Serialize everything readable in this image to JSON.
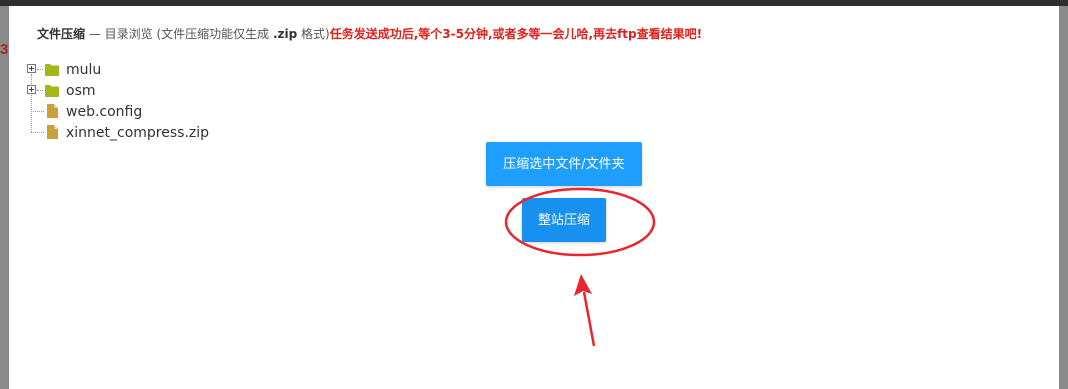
{
  "header": {
    "title": "文件压缩",
    "subtitle": " — 目录浏览 (文件压缩功能仅生成 ",
    "ext": ".zip",
    "subtitle_end": " 格式)",
    "warning": "任务发送成功后,等个3-5分钟,或者多等一会儿哈,再去ftp查看结果吧!"
  },
  "edge_fragment": "3",
  "tree": {
    "items": [
      {
        "label": "mulu",
        "type": "folder",
        "icon": "folder-icon"
      },
      {
        "label": "osm",
        "type": "folder",
        "icon": "folder-icon"
      },
      {
        "label": "web.config",
        "type": "file",
        "icon": "file-icon"
      },
      {
        "label": "xinnet_compress.zip",
        "type": "file",
        "icon": "file-icon"
      }
    ]
  },
  "actions": {
    "compress_selected": "压缩选中文件/文件夹",
    "compress_site": "整站压缩"
  },
  "colors": {
    "accent": "#1e9fff",
    "warning": "#e0211b",
    "annotation": "#e8262d",
    "folder": "#a5b51c",
    "file": "#c9a03a"
  }
}
